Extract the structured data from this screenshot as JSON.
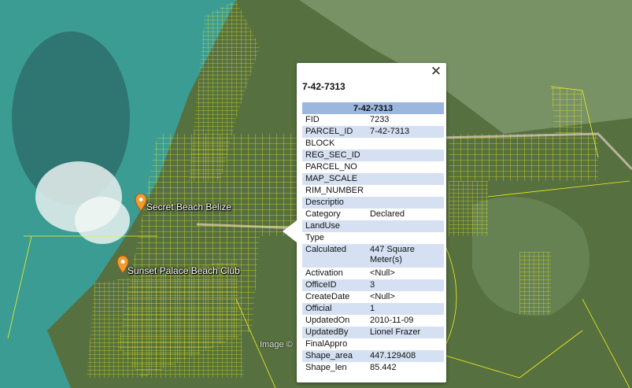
{
  "map": {
    "colors": {
      "water": "#3fa59f",
      "land": "#4f6b45",
      "parcel_line": "#f4f020"
    },
    "places": [
      {
        "name": "Secret Beach Belize",
        "icon": "orange-pin-icon"
      },
      {
        "name": "Sunset Palace Beach Club",
        "icon": "orange-pin-icon"
      }
    ],
    "watermark": "Image ©"
  },
  "popup": {
    "title": "7-42-7313",
    "close_label": "✕",
    "table_header": "7-42-7313",
    "fields": [
      {
        "key": "FID",
        "value": "7233"
      },
      {
        "key": "PARCEL_ID",
        "value": "7-42-7313"
      },
      {
        "key": "BLOCK",
        "value": ""
      },
      {
        "key": "REG_SEC_ID",
        "value": ""
      },
      {
        "key": "PARCEL_NO",
        "value": ""
      },
      {
        "key": "MAP_SCALE",
        "value": ""
      },
      {
        "key": "RIM_NUMBER",
        "value": ""
      },
      {
        "key": "Descriptio",
        "value": ""
      },
      {
        "key": "Category",
        "value": "Declared"
      },
      {
        "key": "LandUse",
        "value": ""
      },
      {
        "key": "Type",
        "value": ""
      },
      {
        "key": "Calculated",
        "value": "447 Square Meter(s)"
      },
      {
        "key": "Activation",
        "value": "<Null>"
      },
      {
        "key": "OfficeID",
        "value": "3"
      },
      {
        "key": "CreateDate",
        "value": "<Null>"
      },
      {
        "key": "Official",
        "value": "1"
      },
      {
        "key": "UpdatedOn",
        "value": "2010-11-09"
      },
      {
        "key": "UpdatedBy",
        "value": "Lionel Frazer"
      },
      {
        "key": "FinalAppro",
        "value": ""
      },
      {
        "key": "Shape_area",
        "value": "447.129408"
      },
      {
        "key": "Shape_len",
        "value": "85.442"
      }
    ]
  }
}
